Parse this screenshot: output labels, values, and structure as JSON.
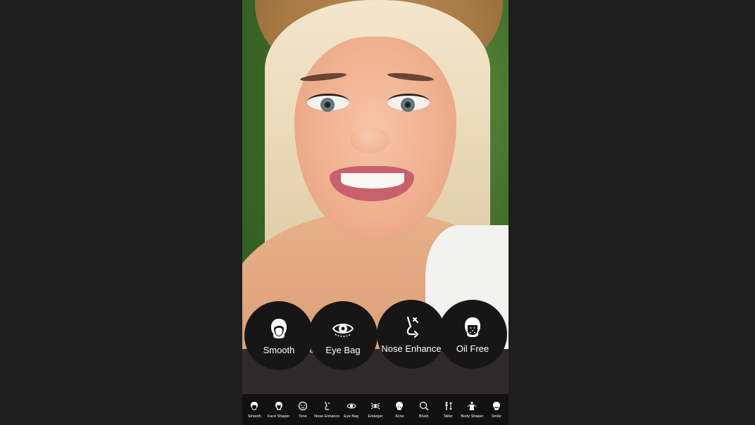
{
  "features": [
    {
      "label": "Smooth",
      "icon": "face-smooth-icon"
    },
    {
      "label": "Eye Bag",
      "icon": "eye-bag-icon"
    },
    {
      "label": "Nose Enhance",
      "icon": "nose-enhance-icon"
    },
    {
      "label": "Oil Free",
      "icon": "oil-free-icon"
    }
  ],
  "peek_text": "e",
  "toolbar": [
    {
      "label": "Smooth",
      "icon": "face-smooth-icon"
    },
    {
      "label": "Face Shaper",
      "icon": "face-shaper-icon"
    },
    {
      "label": "Tone",
      "icon": "tone-icon"
    },
    {
      "label": "Nose Enhance",
      "icon": "nose-enhance-icon"
    },
    {
      "label": "Eye Bag",
      "icon": "eye-bag-icon"
    },
    {
      "label": "Enlarger",
      "icon": "eye-enlarger-icon"
    },
    {
      "label": "Acne",
      "icon": "acne-icon"
    },
    {
      "label": "Blush",
      "icon": "blush-icon"
    },
    {
      "label": "Taller",
      "icon": "taller-icon"
    },
    {
      "label": "Body Shaper",
      "icon": "body-shaper-icon"
    },
    {
      "label": "Smile",
      "icon": "smile-icon"
    }
  ],
  "colors": {
    "background": "#1e1e1e",
    "panel": "#2f2b2d",
    "button": "#161616",
    "toolbar": "#111111",
    "text": "#ffffff"
  }
}
